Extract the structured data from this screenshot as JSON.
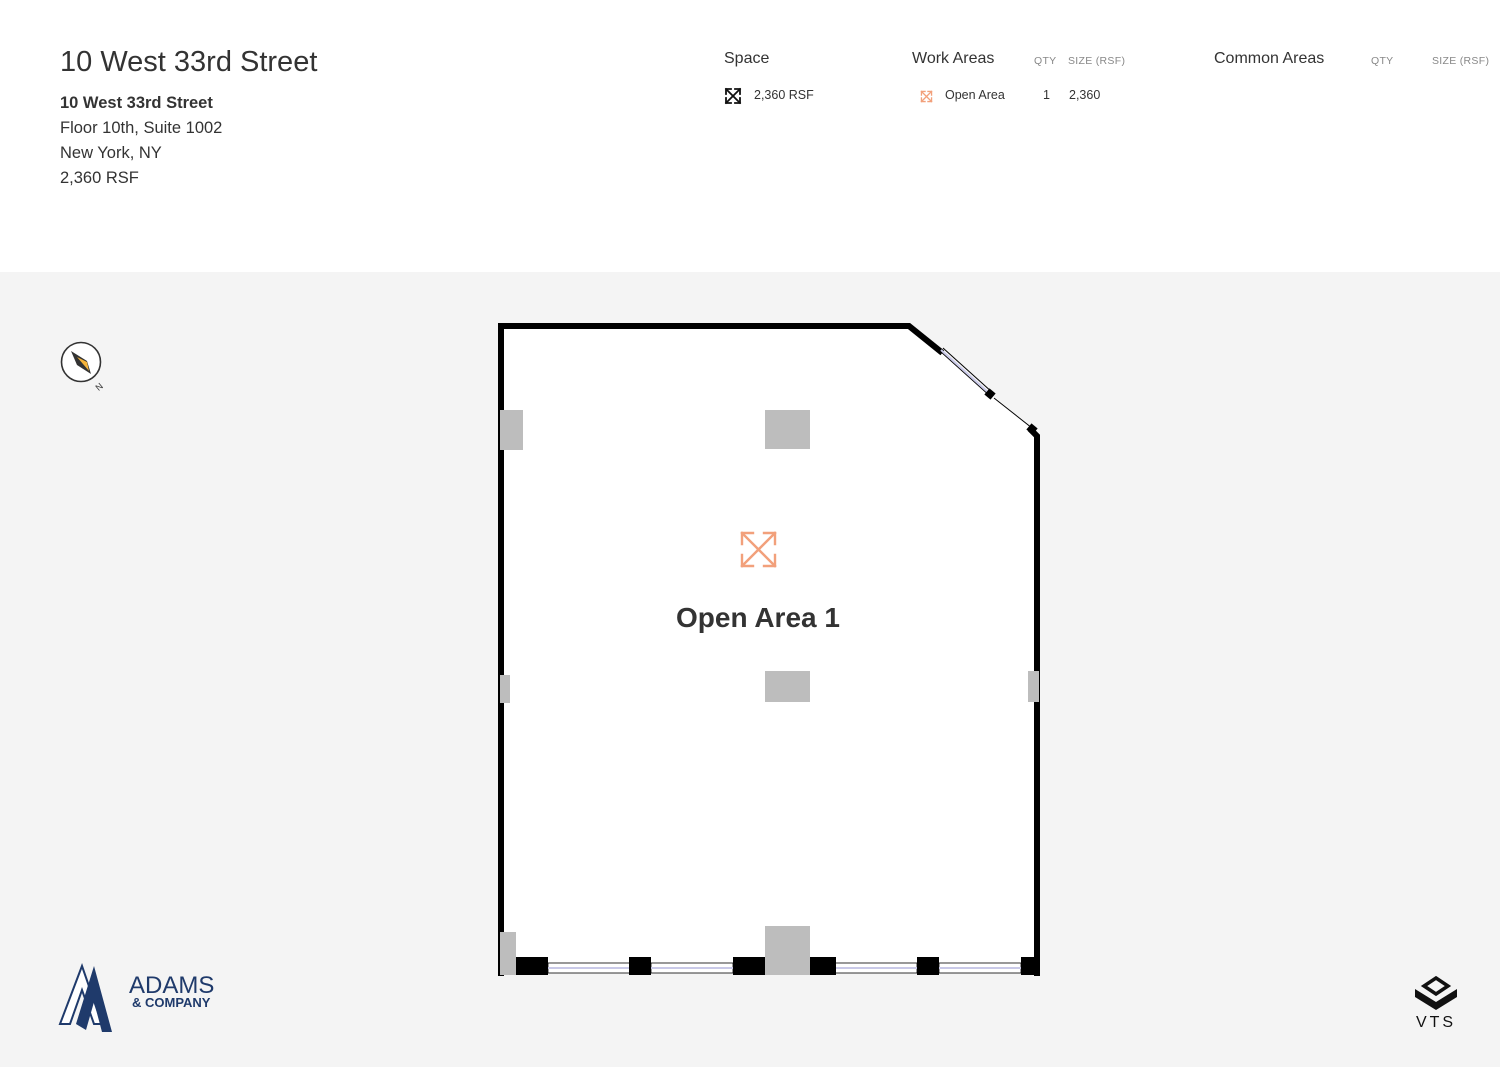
{
  "header": {
    "title": "10 West 33rd Street",
    "address_name": "10 West 33rd Street",
    "address_suite": "Floor 10th, Suite 1002",
    "address_city": "New York, NY",
    "address_size": "2,360 RSF"
  },
  "space": {
    "heading": "Space",
    "total": "2,360 RSF",
    "icon": "expand-arrows-icon"
  },
  "work_areas": {
    "heading": "Work Areas",
    "qty_label": "QTY",
    "size_label": "SIZE (RSF)",
    "rows": [
      {
        "name": "Open Area",
        "qty": "1",
        "size": "2,360",
        "icon": "open-area-icon",
        "color": "#f2a07b"
      }
    ]
  },
  "common_areas": {
    "heading": "Common Areas",
    "qty_label": "QTY",
    "size_label": "SIZE (RSF)",
    "rows": []
  },
  "floor_plan": {
    "room_label": "Open Area 1",
    "room_icon": "open-area-icon",
    "accent_color": "#f2a07b",
    "wall_color": "#000000",
    "column_color": "#bdbdbd"
  },
  "compass": {
    "label": "N",
    "icon": "compass-icon"
  },
  "branding": {
    "company_line1": "ADAMS",
    "company_line2": "& COMPANY",
    "company_color": "#1f3a6b",
    "platform": "VTS"
  }
}
